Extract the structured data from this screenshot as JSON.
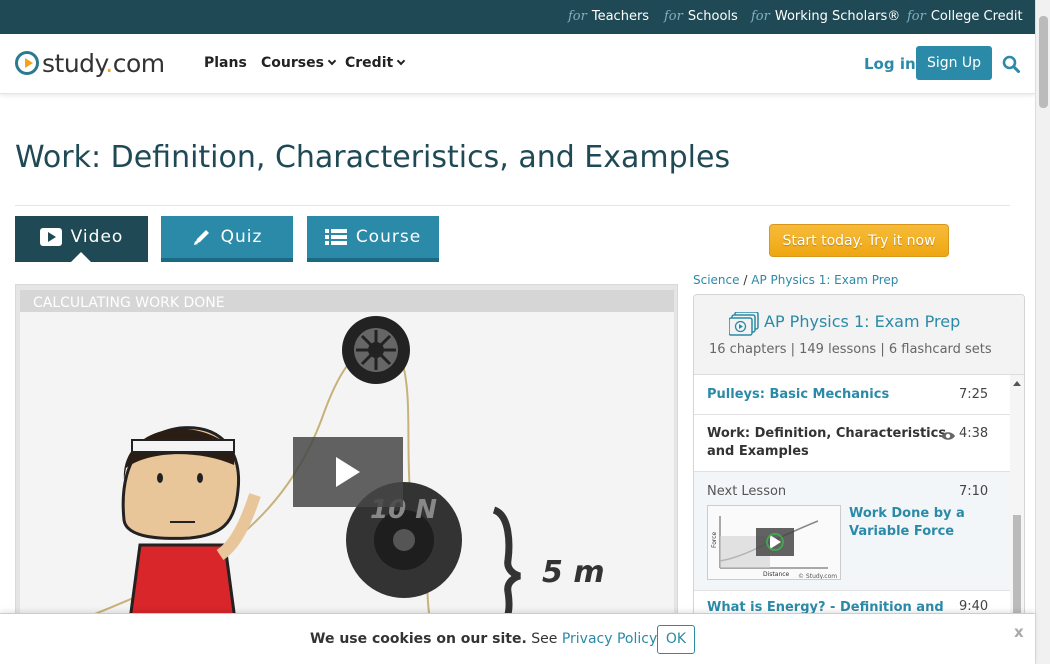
{
  "topbar": {
    "for_word": "for",
    "links": [
      "Teachers",
      "Schools",
      "Working Scholars®",
      "College Credit"
    ]
  },
  "header": {
    "logo_text": "study",
    "logo_dot": ".",
    "logo_suffix": "com",
    "nav": [
      "Plans",
      "Courses",
      "Credit"
    ],
    "login": "Log in",
    "signup": "Sign Up"
  },
  "page": {
    "title": "Work: Definition, Characteristics, and Examples",
    "tabs": [
      {
        "label": "Video",
        "active": true
      },
      {
        "label": "Quiz",
        "active": false
      },
      {
        "label": "Course",
        "active": false
      }
    ],
    "cta": "Start today. Try it now"
  },
  "video": {
    "slide_title": "CALCULATING WORK DONE",
    "force_label": "10 N",
    "distance_label": "5 m"
  },
  "sidebar": {
    "breadcrumb": [
      "Science",
      "AP Physics 1: Exam Prep"
    ],
    "breadcrumb_sep": "/",
    "course_name": "AP Physics 1: Exam Prep",
    "course_stats": "16 chapters | 149 lessons | 6 flashcard sets",
    "lessons": [
      {
        "title": "Pulleys: Basic Mechanics",
        "duration": "7:25"
      },
      {
        "title_line1": "Work: Definition, Characteristics,",
        "title_line2": "and Examples",
        "duration": "4:38"
      },
      {
        "label": "Next Lesson",
        "title_line1": "Work Done by a",
        "title_line2": "Variable Force",
        "duration": "7:10"
      },
      {
        "title": "What is Energy? - Definition and",
        "duration": "9:40"
      }
    ],
    "thumb_watermark": "© Study.com",
    "thumb_axis_x": "Distance",
    "thumb_axis_y": "Force"
  },
  "cookie": {
    "bold": "We use cookies on our site.",
    "see": "See",
    "link": "Privacy Policy",
    "ok": "OK",
    "close": "x"
  },
  "colors": {
    "topbar_bg": "#1f4a55",
    "brand_teal": "#2b8aa8",
    "tab_active": "#1f4a55",
    "cta_orange": "#f4ae20",
    "logo_orange": "#f4a21a"
  }
}
